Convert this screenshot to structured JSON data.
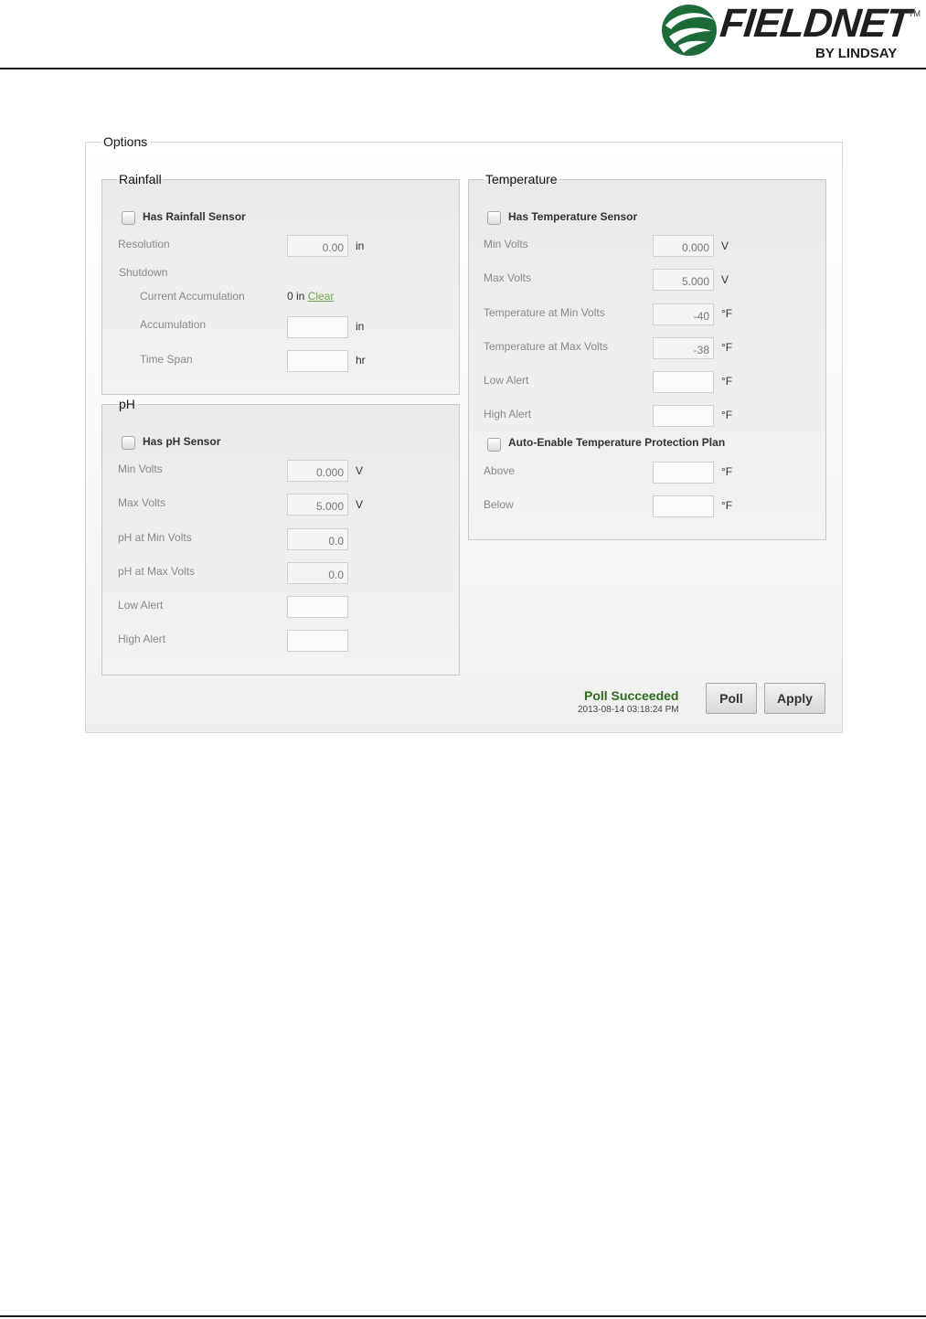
{
  "header": {
    "brand": "FIELDNET",
    "trademark": "TM",
    "byline": "BY LINDSAY",
    "colors": {
      "brand_green": "#1e6b3a",
      "brand_dark": "#1f1f1f"
    }
  },
  "options": {
    "title": "Options",
    "rainfall": {
      "title": "Rainfall",
      "has_sensor_label": "Has Rainfall Sensor",
      "resolution_label": "Resolution",
      "resolution_value": "0.00",
      "resolution_unit": "in",
      "shutdown_label": "Shutdown",
      "current_accumulation_label": "Current Accumulation",
      "current_accumulation_value": "0 in",
      "clear_link": "Clear",
      "accumulation_label": "Accumulation",
      "accumulation_unit": "in",
      "time_span_label": "Time Span",
      "time_span_unit": "hr"
    },
    "ph": {
      "title": "pH",
      "has_sensor_label": "Has pH Sensor",
      "min_volts_label": "Min Volts",
      "min_volts_value": "0.000",
      "min_volts_unit": "V",
      "max_volts_label": "Max Volts",
      "max_volts_value": "5.000",
      "max_volts_unit": "V",
      "ph_min_label": "pH at Min Volts",
      "ph_min_value": "0.0",
      "ph_max_label": "pH at Max Volts",
      "ph_max_value": "0.0",
      "low_alert_label": "Low Alert",
      "high_alert_label": "High Alert"
    },
    "temperature": {
      "title": "Temperature",
      "has_sensor_label": "Has Temperature Sensor",
      "min_volts_label": "Min Volts",
      "min_volts_value": "0.000",
      "min_volts_unit": "V",
      "max_volts_label": "Max Volts",
      "max_volts_value": "5.000",
      "max_volts_unit": "V",
      "temp_min_label": "Temperature at Min Volts",
      "temp_min_value": "-40",
      "temp_max_label": "Temperature at Max Volts",
      "temp_max_value": "-38",
      "low_alert_label": "Low Alert",
      "high_alert_label": "High Alert",
      "auto_enable_label": "Auto-Enable Temperature Protection Plan",
      "above_label": "Above",
      "below_label": "Below",
      "unit_f": "°F"
    },
    "status": {
      "title": "Poll Succeeded",
      "timestamp": "2013-08-14 03:18:24 PM"
    },
    "buttons": {
      "poll": "Poll",
      "apply": "Apply"
    }
  }
}
